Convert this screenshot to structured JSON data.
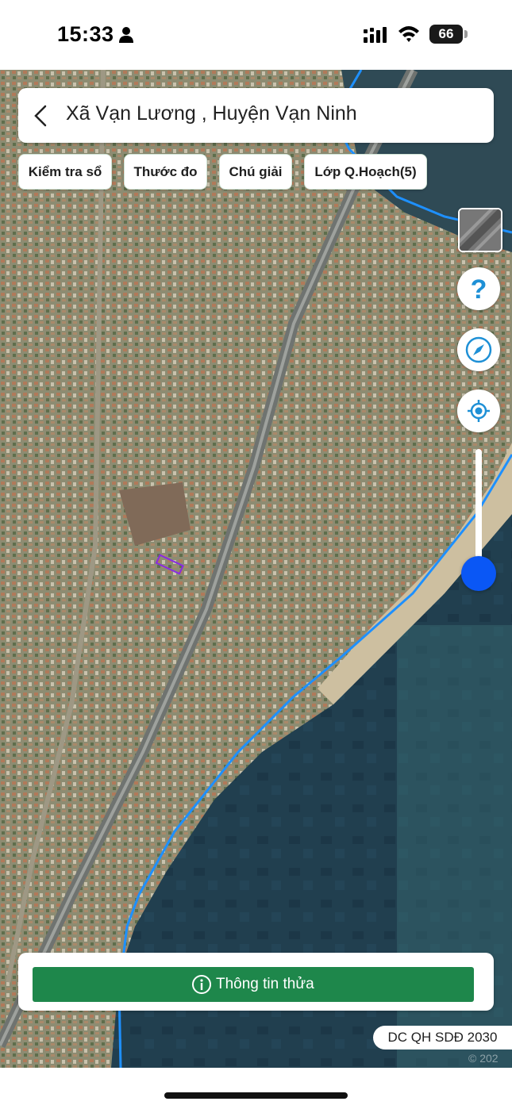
{
  "status_bar": {
    "time": "15:33",
    "battery": "66",
    "icons": [
      "person-icon",
      "cellular-signal-icon",
      "wifi-icon",
      "battery-icon"
    ]
  },
  "header": {
    "title": "Xã Vạn Lương , Huyện Vạn Ninh",
    "back_icon": "chevron-left-icon"
  },
  "chips": [
    {
      "label": "Kiểm tra sổ"
    },
    {
      "label": "Thước đo"
    },
    {
      "label": "Chú giải"
    },
    {
      "label": "Lớp Q.Hoạch(5)"
    }
  ],
  "map_controls": {
    "layer_switch": "satellite-layer-thumbnail",
    "help_icon": "question-mark-icon",
    "compass_icon": "compass-icon",
    "locate_icon": "crosshair-location-icon",
    "zoom_level": 0.12
  },
  "bottom_panel": {
    "button_label": "Thông tin thửa",
    "button_icon": "info-circle-icon"
  },
  "plan_badge": "DC QH SDĐ 2030",
  "map_watermark": "© 202",
  "colors": {
    "primary_green": "#1e874b",
    "boundary_blue": "#1e90ff",
    "zoom_blue": "#0a57f5",
    "parcel_purple": "#8a2be2",
    "sea": "#1d3b4c",
    "land": "#8c8a6c"
  }
}
